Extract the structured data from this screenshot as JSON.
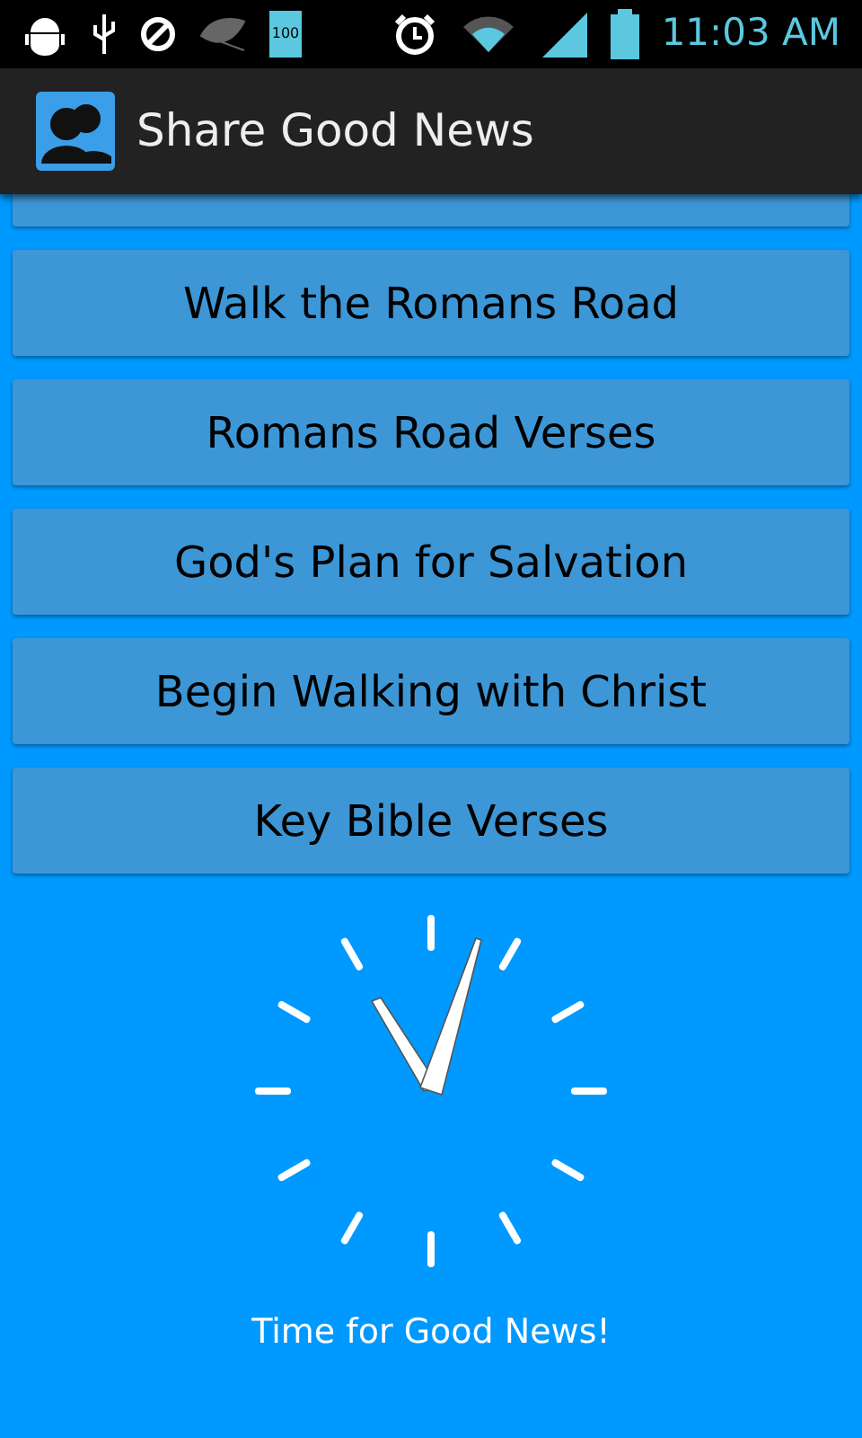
{
  "status_bar": {
    "battery_text": "100",
    "time": "11:03 AM"
  },
  "app_bar": {
    "title": "Share Good News"
  },
  "menu_buttons": [
    {
      "label": "Walk the Romans Road"
    },
    {
      "label": "Romans Road Verses"
    },
    {
      "label": "God's Plan for Salvation"
    },
    {
      "label": "Begin Walking with Christ"
    },
    {
      "label": "Key Bible Verses"
    }
  ],
  "caption": "Time for Good News!"
}
